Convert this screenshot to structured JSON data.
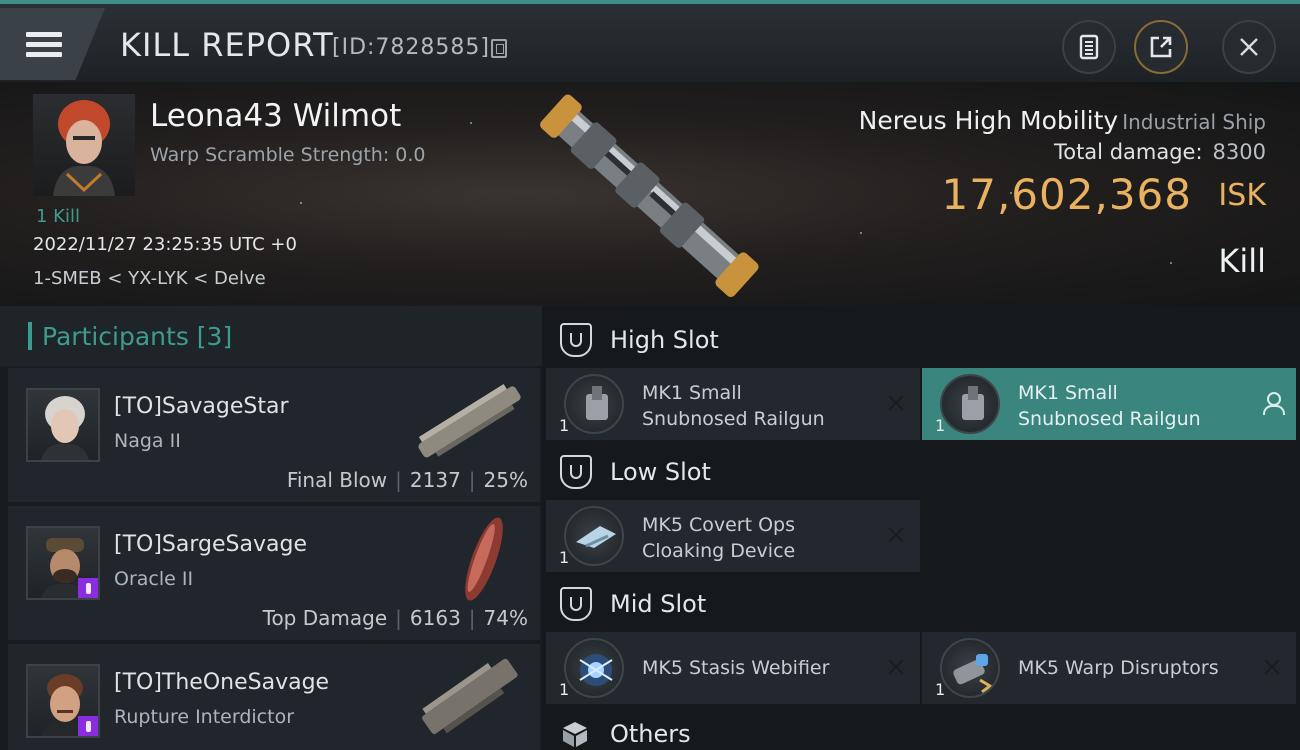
{
  "header": {
    "title": "KILL REPORT",
    "report_id": "[ID:7828585]"
  },
  "victim": {
    "name": "Leona43 Wilmot",
    "warp_scramble": "Warp Scramble Strength: 0.0",
    "kills": "1 Kill",
    "timestamp": "2022/11/27 23:25:35 UTC +0",
    "location": "1-SMEB < YX-LYK < Delve",
    "ship_name": "Nereus High Mobility",
    "ship_class": "Industrial Ship",
    "total_damage_label": "Total damage:",
    "total_damage_value": "8300",
    "isk_value": "17,602,368",
    "isk_unit": "ISK",
    "kill_type": "Kill"
  },
  "participants": {
    "label": "Participants [3]",
    "rows": [
      {
        "name": "[TO]SavageStar",
        "ship": "Naga II",
        "tag": "Final Blow",
        "damage": "2137",
        "percent": "25%"
      },
      {
        "name": "[TO]SargeSavage",
        "ship": "Oracle II",
        "tag": "Top Damage",
        "damage": "6163",
        "percent": "74%"
      },
      {
        "name": "[TO]TheOneSavage",
        "ship": "Rupture Interdictor"
      }
    ]
  },
  "fitting": {
    "high": {
      "label": "High Slot",
      "modules": [
        {
          "qty": "1",
          "line1": "MK1 Small",
          "line2": "Snubnosed Railgun"
        },
        {
          "qty": "1",
          "line1": "MK1 Small",
          "line2": "Snubnosed Railgun"
        }
      ]
    },
    "low": {
      "label": "Low Slot",
      "modules": [
        {
          "qty": "1",
          "line1": "MK5 Covert Ops",
          "line2": "Cloaking Device"
        }
      ]
    },
    "mid": {
      "label": "Mid Slot",
      "modules": [
        {
          "qty": "1",
          "line1": "MK5 Stasis Webifier"
        },
        {
          "qty": "1",
          "line1": "MK5 Warp Disruptors"
        }
      ]
    },
    "others": {
      "label": "Others"
    }
  },
  "colors": {
    "accent_teal": "#3d9b8f",
    "isk_gold": "#e8b260",
    "active_module": "#3a857d",
    "badge_purple": "#8a2ce0"
  }
}
